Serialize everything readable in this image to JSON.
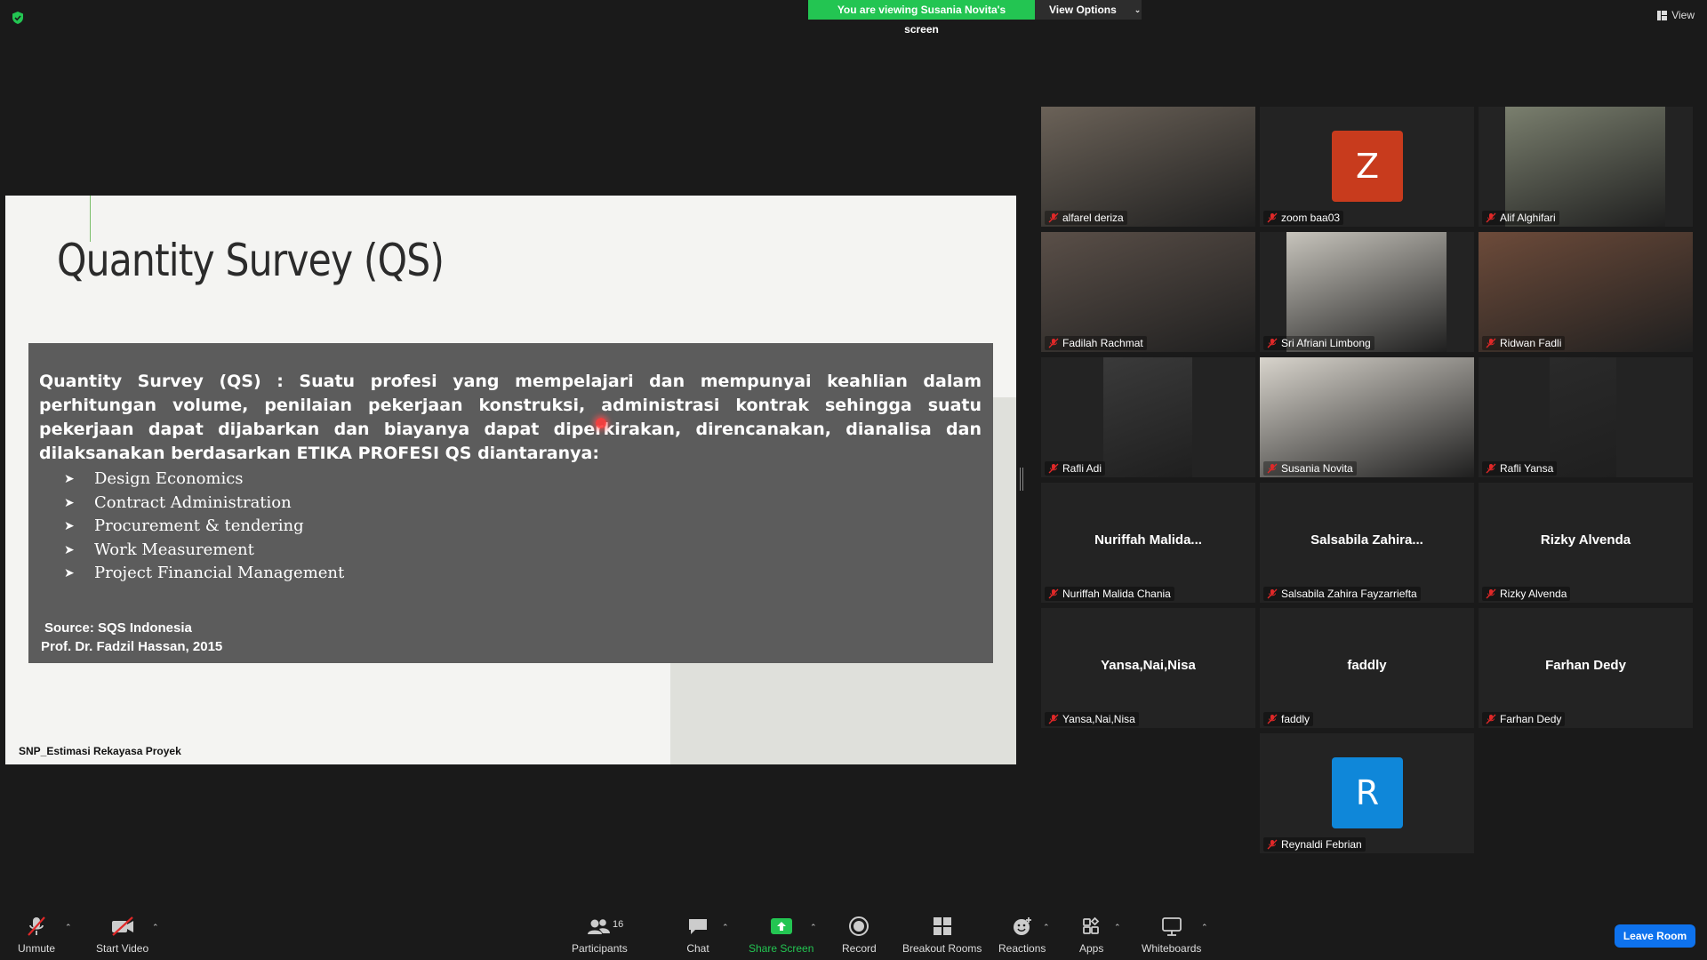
{
  "top": {
    "banner_text": "You are viewing Susania Novita's screen",
    "view_options": "View Options",
    "view": "View"
  },
  "slide": {
    "title": "Quantity Survey (QS)",
    "paragraph": "Quantity Survey (QS) : Suatu profesi yang mempelajari dan mempunyai keahlian dalam perhitungan volume, penilaian pekerjaan konstruksi, administrasi kontrak sehingga suatu pekerjaan dapat dijabarkan dan biayanya dapat diperkirakan, direncanakan, dianalisa dan dilaksanakan berdasarkan ETIKA PROFESI QS diantaranya:",
    "items": [
      "Design Economics",
      "Contract Administration",
      "Procurement & tendering",
      "Work Measurement",
      "Project Financial Management"
    ],
    "source": "Source: SQS Indonesia",
    "prof": "Prof. Dr. Fadzil Hassan, 2015",
    "footer": "SNP_Estimasi Rekayasa Proyek"
  },
  "participants": [
    {
      "name": "alfarel deriza"
    },
    {
      "name": "zoom baa03",
      "avatar": "Z",
      "avatar_color": "#c83b1d"
    },
    {
      "name": "Alif Alghifari"
    },
    {
      "name": "Fadilah Rachmat"
    },
    {
      "name": "Sri Afriani Limbong"
    },
    {
      "name": "Ridwan Fadli"
    },
    {
      "name": "Rafli Adi"
    },
    {
      "name": "Susania Novita"
    },
    {
      "name": "Rafli Yansa"
    },
    {
      "name": "Nuriffah Malida Chania",
      "display": "Nuriffah  Malida..."
    },
    {
      "name": "Salsabila Zahira Fayzarriefta",
      "display": "Salsabila  Zahira..."
    },
    {
      "name": "Rizky Alvenda",
      "display": "Rizky Alvenda"
    },
    {
      "name": "Yansa,Nai,Nisa",
      "display": "Yansa,Nai,Nisa"
    },
    {
      "name": "faddly",
      "display": "faddly"
    },
    {
      "name": "Farhan Dedy",
      "display": "Farhan Dedy"
    },
    {
      "name": "Reynaldi Febrian",
      "avatar": "R",
      "avatar_color": "#0f87d9"
    }
  ],
  "toolbar": {
    "unmute": "Unmute",
    "start_video": "Start Video",
    "participants": "Participants",
    "participants_count": "16",
    "chat": "Chat",
    "share_screen": "Share Screen",
    "record": "Record",
    "breakout_rooms": "Breakout Rooms",
    "reactions": "Reactions",
    "apps": "Apps",
    "whiteboards": "Whiteboards",
    "leave_room": "Leave Room"
  },
  "colors": {
    "share_green": "#23c552",
    "leave_blue": "#0e72ed",
    "active_speaker": "#e9f06b"
  }
}
